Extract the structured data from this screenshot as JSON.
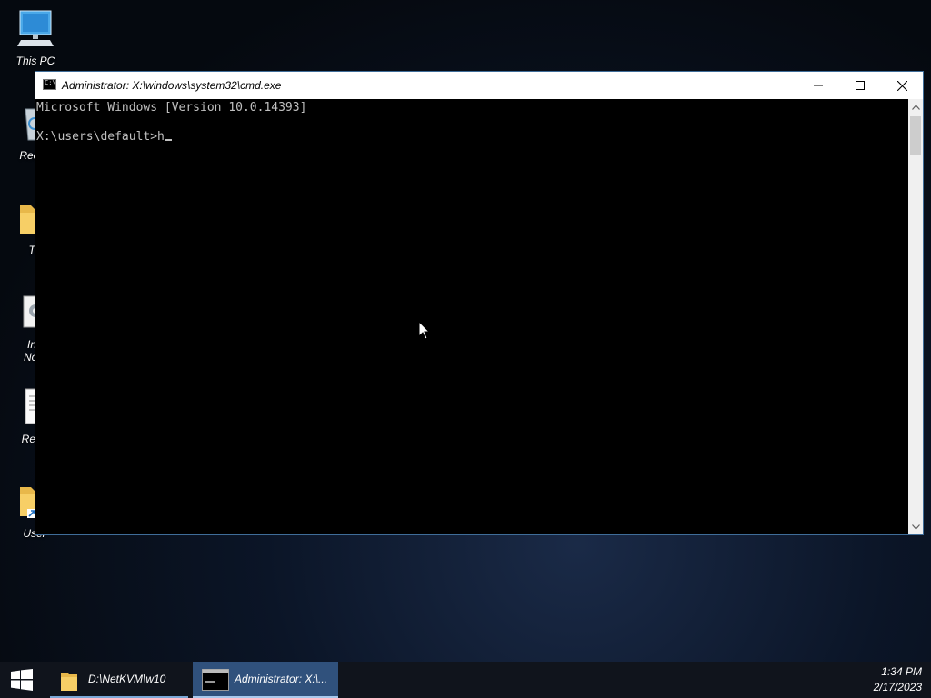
{
  "desktop": {
    "icons": [
      {
        "label": "This PC",
        "icon": "this-pc-icon"
      },
      {
        "label": "Recyc",
        "icon": "recycle-bin-icon"
      },
      {
        "label": "To",
        "icon": "folder-icon"
      },
      {
        "label": "Ins",
        "label2": "Now",
        "icon": "installer-icon"
      },
      {
        "label": "Read",
        "icon": "text-document-icon"
      },
      {
        "label": "User",
        "icon": "folder-shortcut-icon"
      }
    ]
  },
  "window": {
    "title": "Administrator: X:\\windows\\system32\\cmd.exe",
    "icon_text": "C:\\",
    "console_lines": [
      "Microsoft Windows [Version 10.0.14393]",
      "",
      "X:\\users\\default>h"
    ]
  },
  "taskbar": {
    "items": [
      {
        "label": "D:\\NetKVM\\w10",
        "icon": "folder-icon",
        "active": false
      },
      {
        "label": "Administrator: X:\\...",
        "icon": "command-prompt-icon",
        "active": true
      }
    ],
    "clock": {
      "time": "1:34 PM",
      "date": "2/17/2023"
    }
  },
  "colors": {
    "console_bg": "#000000",
    "console_fg": "#c0c0c0",
    "taskbar_bg": "#10141c",
    "active_task": "#30517c",
    "window_border": "#3f6d99"
  }
}
